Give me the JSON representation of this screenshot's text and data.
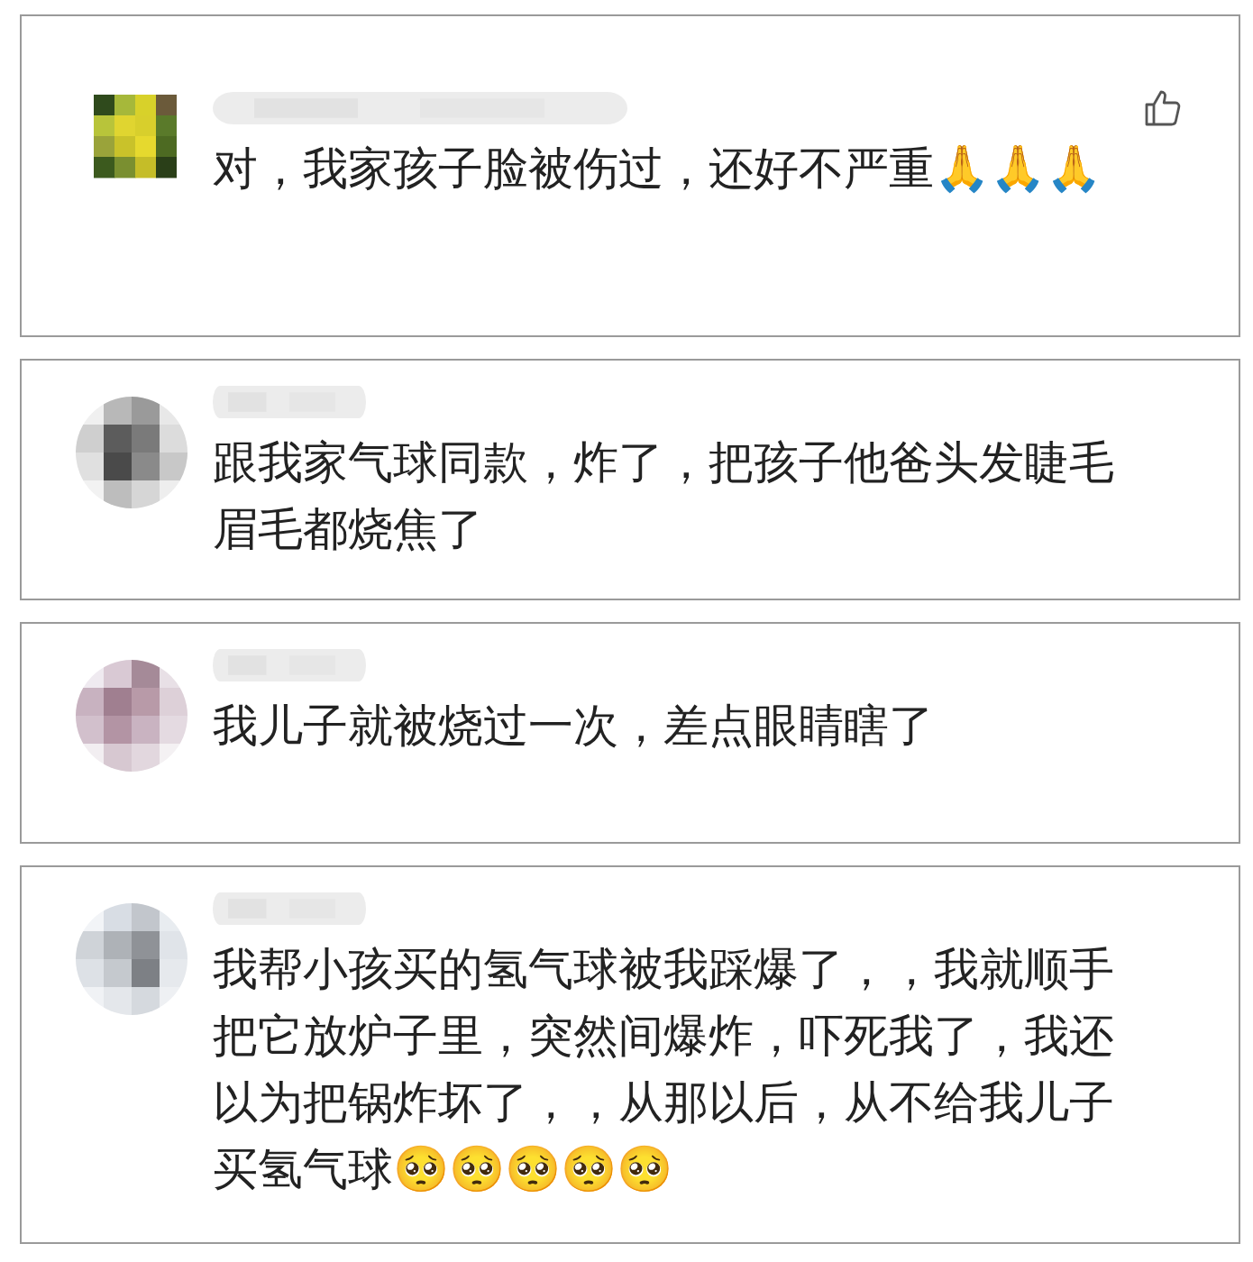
{
  "comments": [
    {
      "like_button": true,
      "text": "对，我家孩子脸被伤过，还好不严重🙏🙏🙏"
    },
    {
      "like_button": false,
      "text": "跟我家气球同款，炸了，把孩子他爸头发睫毛眉毛都烧焦了"
    },
    {
      "like_button": false,
      "text": "我儿子就被烧过一次，差点眼睛瞎了"
    },
    {
      "like_button": false,
      "text": "我帮小孩买的氢气球被我踩爆了，，我就顺手把它放炉子里，突然间爆炸，吓死我了，我还以为把锅炸坏了，，从那以后，从不给我儿子买氢气球🥺🥺🥺🥺🥺"
    }
  ]
}
